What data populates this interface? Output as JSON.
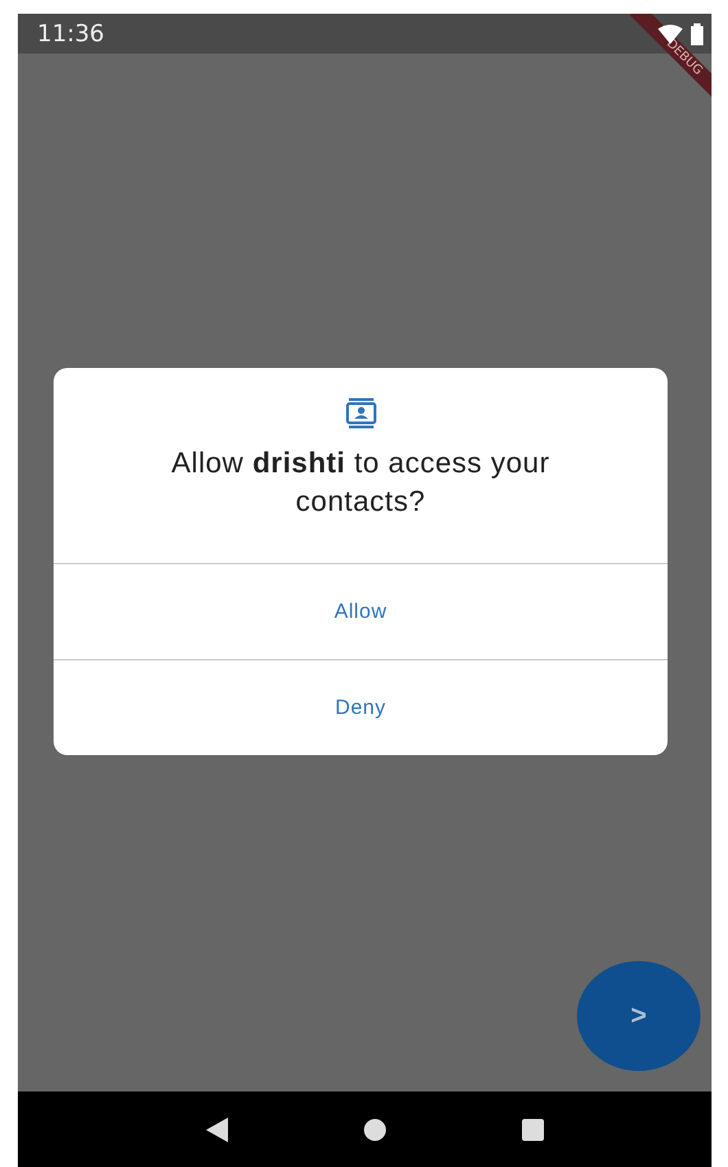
{
  "status_bar": {
    "time": "11:36"
  },
  "debug_banner": {
    "label": "DEBUG"
  },
  "dialog": {
    "title": "Allow **drishti** to access your contacts?",
    "buttons": [
      {
        "label": "Allow"
      },
      {
        "label": "Deny"
      }
    ]
  },
  "fab": {
    "label": ">"
  }
}
